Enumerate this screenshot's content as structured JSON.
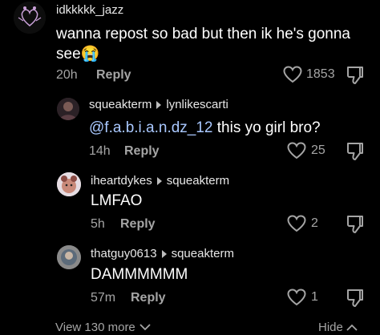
{
  "comments": [
    {
      "username": "idkkkkk_jazz",
      "text": "wanna repost so bad but then ik he's gonna",
      "text_line2": "see",
      "emoji": "😭",
      "time": "20h",
      "reply_label": "Reply",
      "likes": "1853"
    },
    {
      "username": "squeakterm",
      "reply_to": "lynlikescarti",
      "mention": "@f.a.b.i.a.n.dz_12",
      "text": " this yo girl bro?",
      "time": "14h",
      "reply_label": "Reply",
      "likes": "25"
    },
    {
      "username": "iheartdykes",
      "reply_to": "squeakterm",
      "text": "LMFAO",
      "time": "5h",
      "reply_label": "Reply",
      "likes": "2"
    },
    {
      "username": "thatguy0613",
      "reply_to": "squeakterm",
      "text": "DAMMMMMM",
      "time": "57m",
      "reply_label": "Reply",
      "likes": "1"
    }
  ],
  "footer": {
    "view_more": "View 130 more",
    "hide": "Hide"
  },
  "icons": {
    "like": "heart-outline-icon",
    "dislike": "thumbs-down-icon",
    "reply_arrow": "triangle-right-icon",
    "expand": "chevron-down-icon",
    "collapse": "chevron-up-icon"
  },
  "colors": {
    "background": "#000000",
    "text": "#ffffff",
    "muted": "#a5a5a5",
    "mention": "#a9c8ff"
  }
}
